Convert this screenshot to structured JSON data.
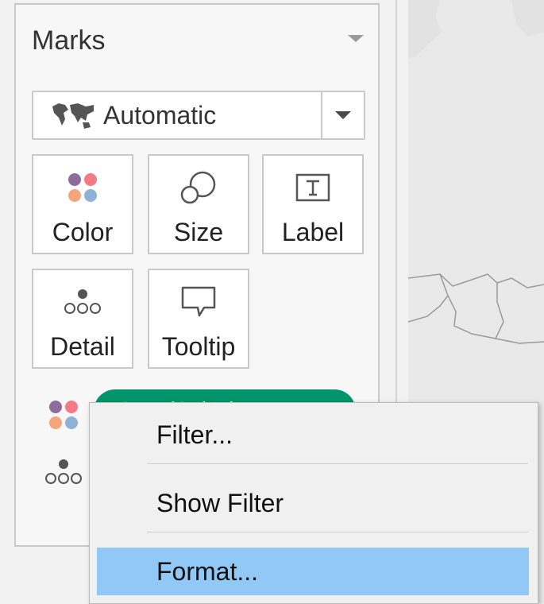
{
  "marks_panel": {
    "title": "Marks",
    "mark_type": {
      "selected": "Automatic",
      "icon": "world-map-icon"
    },
    "cards": [
      {
        "label": "Color",
        "icon": "color-dots-icon"
      },
      {
        "label": "Size",
        "icon": "size-circles-icon"
      },
      {
        "label": "Label",
        "icon": "text-label-icon"
      },
      {
        "label": "Detail",
        "icon": "detail-dots-icon"
      },
      {
        "label": "Tooltip",
        "icon": "speech-bubble-icon"
      }
    ],
    "shelf": {
      "pill_label": "SUM(Sales)",
      "pill_color": "#00956b"
    }
  },
  "context_menu": {
    "items": [
      {
        "label": "Filter..."
      },
      {
        "label": "Show Filter"
      },
      {
        "label": "Format...",
        "highlighted": true
      }
    ],
    "highlight_color": "#91c8f6"
  },
  "colors": {
    "purple": "#8e6c9c",
    "pink": "#f27b86",
    "orange": "#f4a67a",
    "blue": "#8eb2d6"
  }
}
